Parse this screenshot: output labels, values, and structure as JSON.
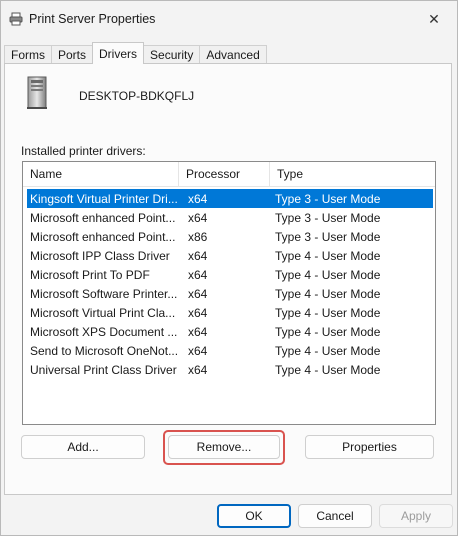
{
  "window": {
    "title": "Print Server Properties",
    "close_glyph": "✕"
  },
  "tabs": [
    {
      "label": "Forms",
      "active": false
    },
    {
      "label": "Ports",
      "active": false
    },
    {
      "label": "Drivers",
      "active": true
    },
    {
      "label": "Security",
      "active": false
    },
    {
      "label": "Advanced",
      "active": false
    }
  ],
  "server": {
    "name": "DESKTOP-BDKQFLJ",
    "icon": "computer-tower-icon"
  },
  "drivers": {
    "section_label": "Installed printer drivers:",
    "columns": [
      "Name",
      "Processor",
      "Type"
    ],
    "rows": [
      {
        "name": "Kingsoft Virtual Printer Dri...",
        "processor": "x64",
        "type": "Type 3 - User Mode",
        "selected": true
      },
      {
        "name": "Microsoft enhanced Point...",
        "processor": "x64",
        "type": "Type 3 - User Mode",
        "selected": false
      },
      {
        "name": "Microsoft enhanced Point...",
        "processor": "x86",
        "type": "Type 3 - User Mode",
        "selected": false
      },
      {
        "name": "Microsoft IPP Class Driver",
        "processor": "x64",
        "type": "Type 4 - User Mode",
        "selected": false
      },
      {
        "name": "Microsoft Print To PDF",
        "processor": "x64",
        "type": "Type 4 - User Mode",
        "selected": false
      },
      {
        "name": "Microsoft Software Printer...",
        "processor": "x64",
        "type": "Type 4 - User Mode",
        "selected": false
      },
      {
        "name": "Microsoft Virtual Print Cla...",
        "processor": "x64",
        "type": "Type 4 - User Mode",
        "selected": false
      },
      {
        "name": "Microsoft XPS Document ...",
        "processor": "x64",
        "type": "Type 4 - User Mode",
        "selected": false
      },
      {
        "name": "Send to Microsoft OneNot...",
        "processor": "x64",
        "type": "Type 4 - User Mode",
        "selected": false
      },
      {
        "name": "Universal Print Class Driver",
        "processor": "x64",
        "type": "Type 4 - User Mode",
        "selected": false
      }
    ]
  },
  "actions": {
    "add_label": "Add...",
    "remove_label": "Remove...",
    "properties_label": "Properties"
  },
  "dialog_buttons": {
    "ok_label": "OK",
    "cancel_label": "Cancel",
    "apply_label": "Apply"
  },
  "colors": {
    "selection": "#0078d7",
    "highlight": "#d9534f",
    "accent": "#0067c0"
  }
}
